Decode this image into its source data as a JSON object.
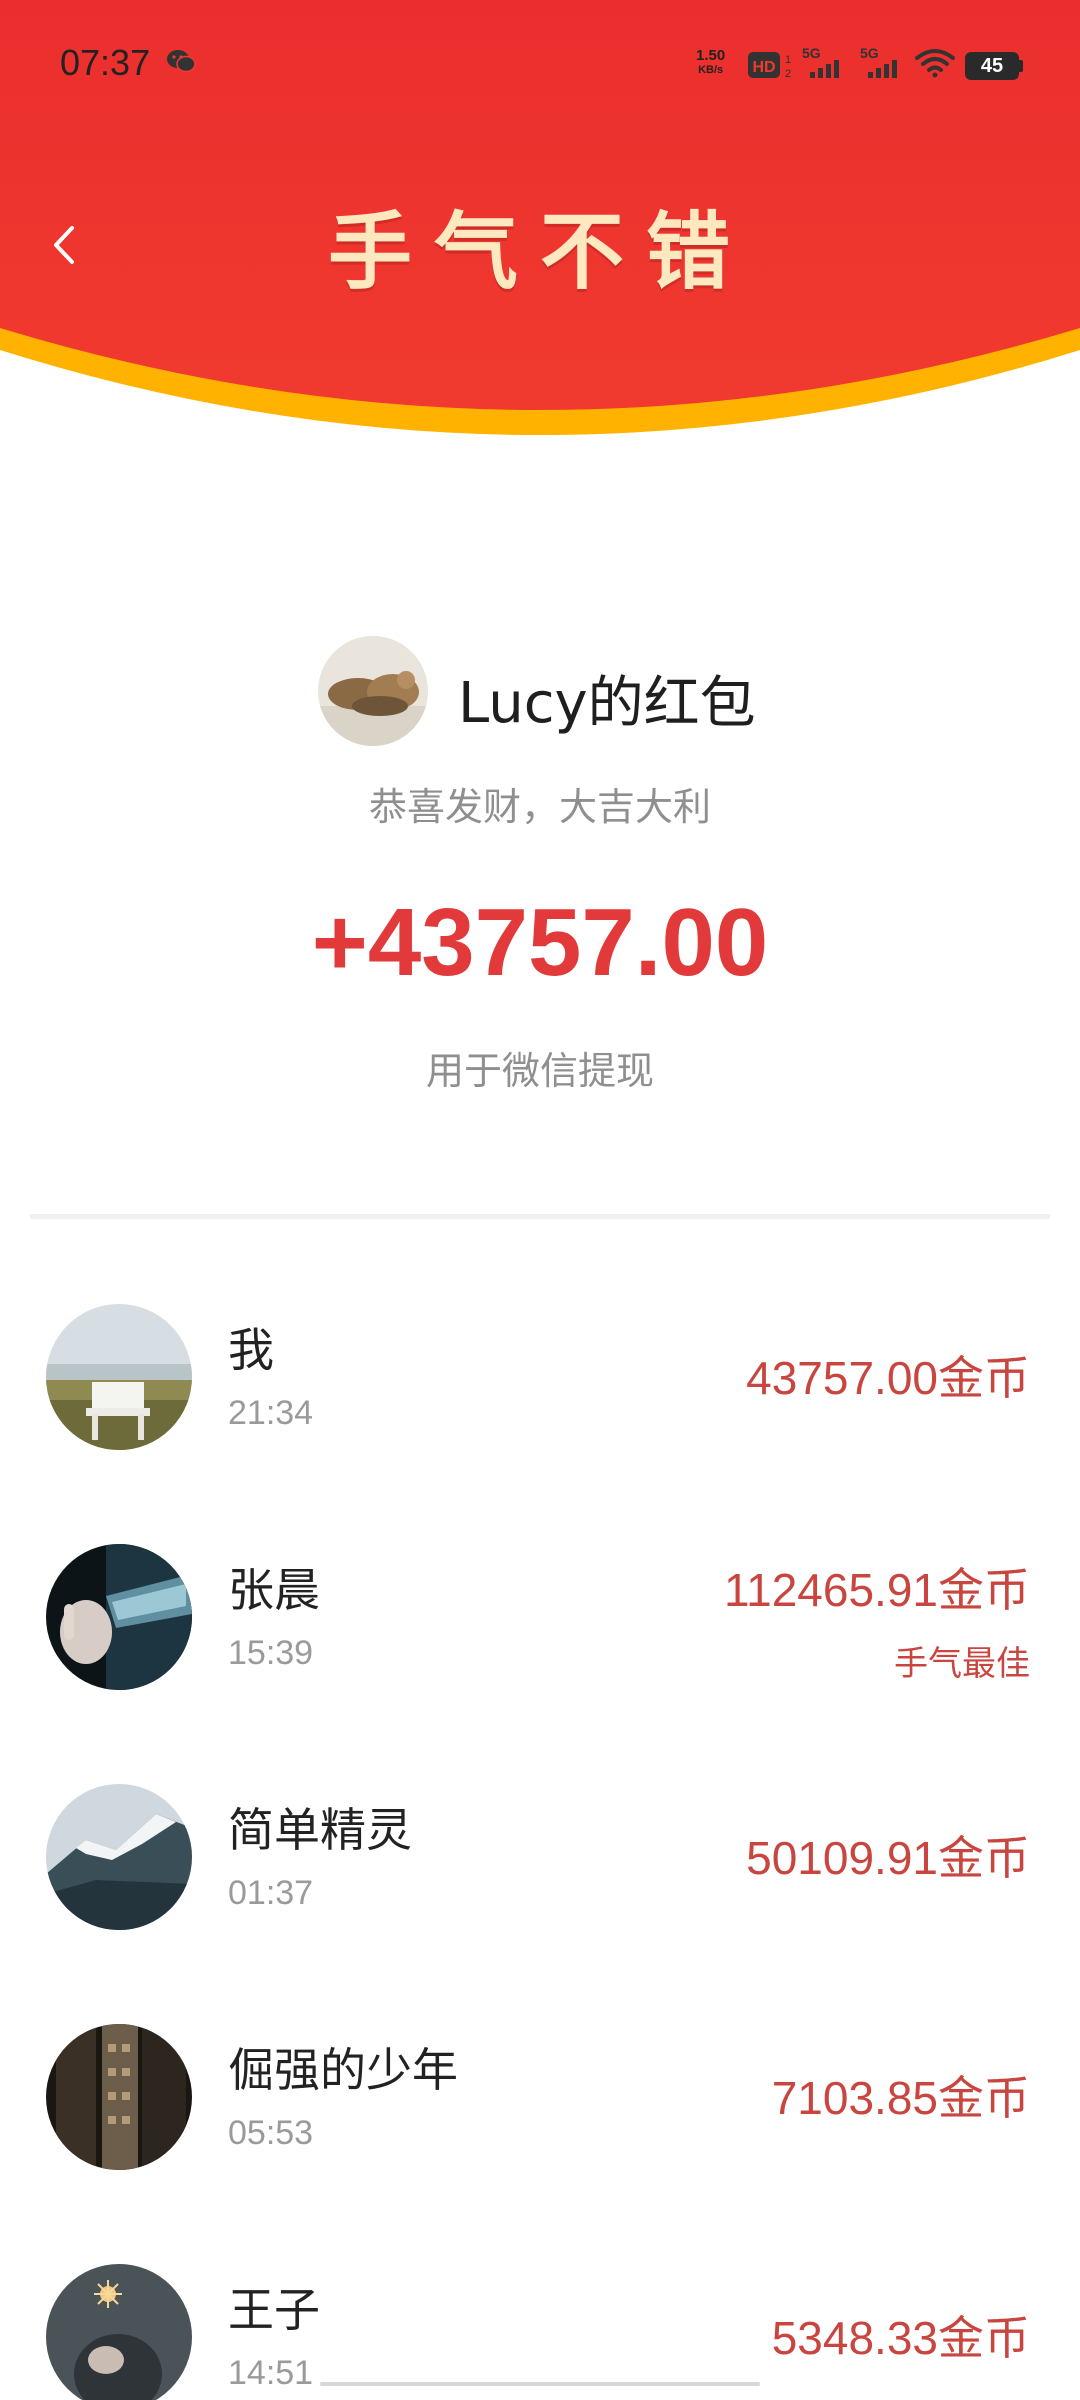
{
  "status_bar": {
    "time": "07:37",
    "net_speed_value": "1.50",
    "net_speed_unit": "KB/s",
    "hd_label": "HD",
    "network_1": "5G",
    "network_2": "5G",
    "battery": "45"
  },
  "header": {
    "title": "手气不错",
    "colors": {
      "red": "#ee2a2a",
      "gold": "#ffb300"
    }
  },
  "packet": {
    "sender_name": "Lucy的红包",
    "blessing": "恭喜发财，大吉大利",
    "amount": "+43757.00",
    "amount_note": "用于微信提现",
    "amount_color": "#e23a3a"
  },
  "records": [
    {
      "name": "我",
      "time": "21:34",
      "amount": "43757.00",
      "unit": "金币",
      "badge": ""
    },
    {
      "name": "张晨",
      "time": "15:39",
      "amount": "112465.91",
      "unit": "金币",
      "badge": "手气最佳"
    },
    {
      "name": "简单精灵",
      "time": "01:37",
      "amount": "50109.91",
      "unit": "金币",
      "badge": ""
    },
    {
      "name": "倔强的少年",
      "time": "05:53",
      "amount": "7103.85",
      "unit": "金币",
      "badge": ""
    },
    {
      "name": "王子",
      "time": "14:51",
      "amount": "5348.33",
      "unit": "金币",
      "badge": ""
    }
  ],
  "icons": {
    "back": "chevron-left-icon",
    "notification": "wechat-icon",
    "wifi": "wifi-icon"
  }
}
